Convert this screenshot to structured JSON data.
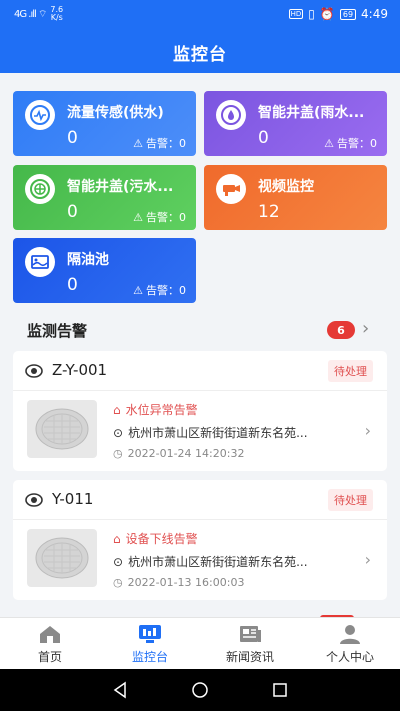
{
  "status_bar": {
    "signal": "4G .ıll ⌔",
    "net_speed": "7.6",
    "net_unit": "K/s",
    "hd": "HD",
    "battery": "69",
    "time": "4:49"
  },
  "header": {
    "title": "监控台"
  },
  "cards": [
    {
      "name": "流量传感(供水)",
      "count": "0",
      "alarm": "告警：0",
      "color": "#2f7cf6"
    },
    {
      "name": "智能井盖(雨水...",
      "count": "0",
      "alarm": "告警：0",
      "color": "#7b55e0"
    },
    {
      "name": "智能井盖(污水...",
      "count": "0",
      "alarm": "告警：0",
      "color": "#45b84a"
    },
    {
      "name": "视频监控",
      "count": "12",
      "color": "#f06a2c"
    },
    {
      "name": "隔油池",
      "count": "0",
      "alarm": "告警：0",
      "color": "#1c55e8"
    }
  ],
  "section": {
    "title": "监测告警",
    "badge": "6"
  },
  "alerts": [
    {
      "id": "Z-Y-001",
      "status": "待处理",
      "type": "水位异常告警",
      "address": "杭州市萧山区新街街道新东名苑...",
      "time": "2022-01-24 14:20:32"
    },
    {
      "id": "Y-011",
      "status": "待处理",
      "type": "设备下线告警",
      "address": "杭州市萧山区新街街道新东名苑...",
      "time": "2022-01-13 16:00:03"
    }
  ],
  "tabs": [
    {
      "label": "首页",
      "icon": "home-icon"
    },
    {
      "label": "监控台",
      "icon": "monitor-icon",
      "active": true
    },
    {
      "label": "新闻资讯",
      "icon": "news-icon"
    },
    {
      "label": "个人中心",
      "icon": "user-icon"
    }
  ],
  "accent": "#1f6ff5"
}
